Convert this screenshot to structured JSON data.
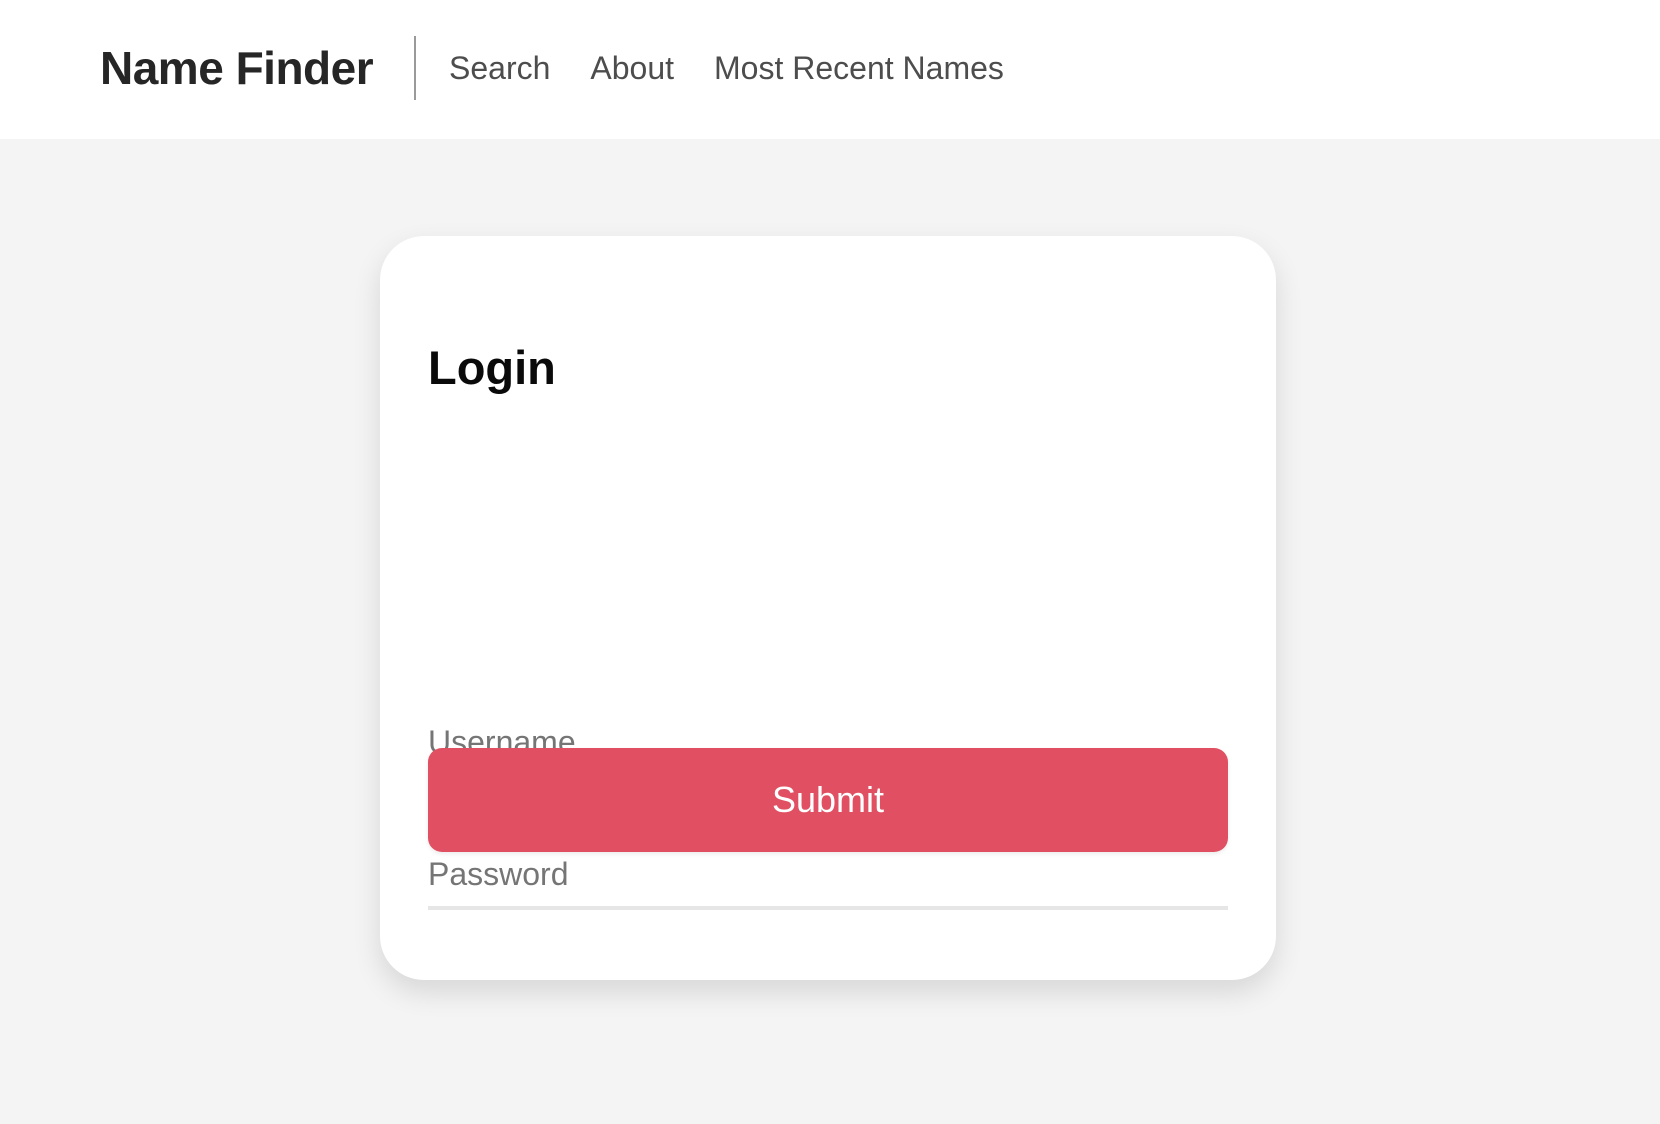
{
  "header": {
    "brand": "Name Finder",
    "nav": {
      "search": "Search",
      "about": "About",
      "recent": "Most Recent Names"
    }
  },
  "login": {
    "title": "Login",
    "username_placeholder": "Username",
    "password_placeholder": "Password",
    "submit_label": "Submit"
  },
  "colors": {
    "accent": "#e04f62",
    "page_background": "#f4f4f4",
    "card_background": "#ffffff"
  }
}
